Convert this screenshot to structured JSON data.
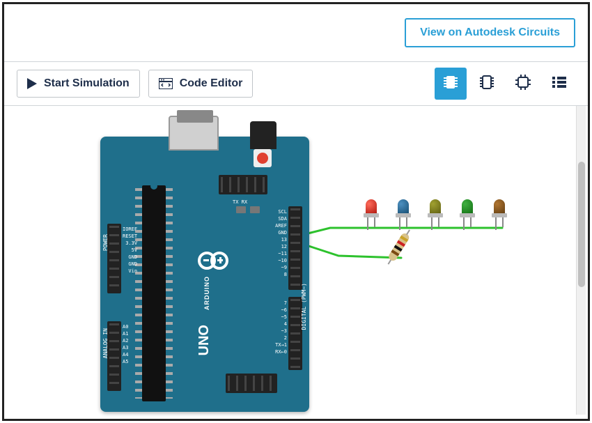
{
  "header": {
    "view_btn_label": "View on Autodesk Circuits"
  },
  "toolbar": {
    "start_simulation_label": "Start Simulation",
    "code_editor_label": "Code Editor"
  },
  "board": {
    "brand": "ARDUINO",
    "model": "UNO",
    "tx_rx": "TX   RX",
    "left_power_pins": [
      "IOREF",
      "RESET",
      "3.3V",
      "5V",
      "GND",
      "GND",
      "Vin"
    ],
    "left_power_group": "POWER",
    "left_analog_pins": [
      "A0",
      "A1",
      "A2",
      "A3",
      "A4",
      "A5"
    ],
    "left_analog_group": "ANALOG IN",
    "right_top_pins": [
      "SCL",
      "SDA",
      "AREF",
      "GND",
      "13",
      "12",
      "~11",
      "~10",
      "~9",
      "8"
    ],
    "right_bot_pins": [
      "7",
      "~6",
      "~5",
      "4",
      "~3",
      "2",
      "TX→1",
      "RX←0"
    ],
    "right_group": "DIGITAL (PWM~)"
  },
  "components": {
    "led_colors": [
      "red",
      "blue",
      "olive",
      "green",
      "orange2"
    ]
  }
}
